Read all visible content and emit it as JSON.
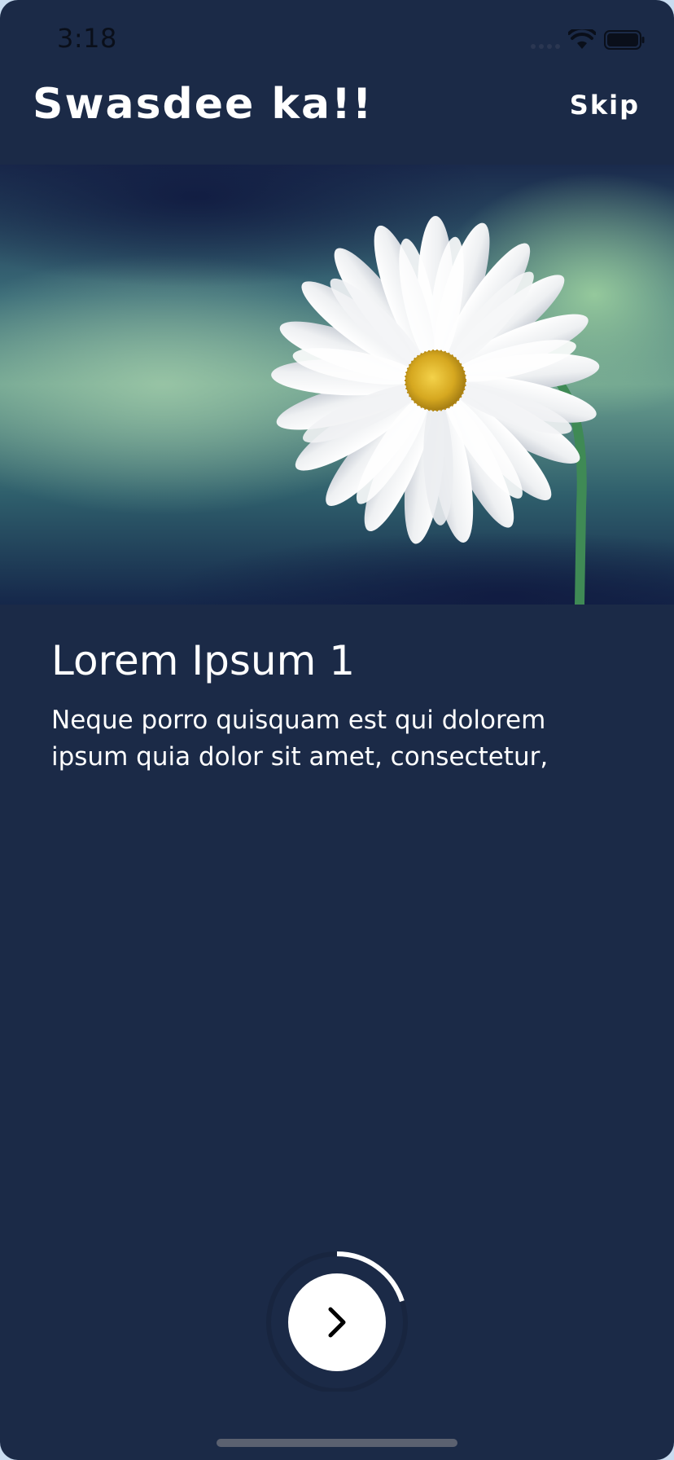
{
  "status_bar": {
    "time": "3:18",
    "icons": [
      "signal-icon",
      "wifi-icon",
      "battery-icon"
    ]
  },
  "header": {
    "title": "Swasdee ka!!",
    "skip_label": "Skip"
  },
  "hero": {
    "image": "daisy-flower-image"
  },
  "content": {
    "title": "Lorem Ipsum 1",
    "body": "Neque porro quisquam est qui dolorem ipsum quia dolor sit amet, consectetur,"
  },
  "next_button": {
    "icon": "chevron-right-icon",
    "progress": 0.2
  },
  "colors": {
    "background": "#1b2a47",
    "text": "#ffffff",
    "button": "#ffffff",
    "progress_ring": "#ffffff"
  }
}
